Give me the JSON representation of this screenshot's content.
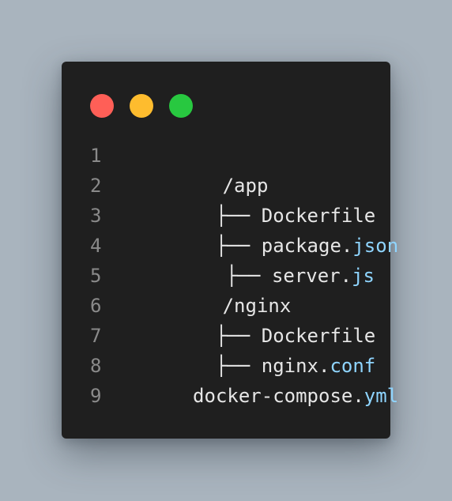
{
  "window": {
    "controls": [
      {
        "name": "close",
        "color": "#ff5f57"
      },
      {
        "name": "minimize",
        "color": "#febc2e"
      },
      {
        "name": "zoom",
        "color": "#28c840"
      }
    ]
  },
  "code": {
    "lines": [
      {
        "number": "1",
        "prefix": "",
        "base": "/app",
        "ext": ""
      },
      {
        "number": "2",
        "prefix": "  ├── ",
        "base": "Dockerfile",
        "ext": ""
      },
      {
        "number": "3",
        "prefix": "  ├── ",
        "base": "package.",
        "ext": "json"
      },
      {
        "number": "4",
        "prefix": "  ├── ",
        "base": "server.",
        "ext": "js"
      },
      {
        "number": "5",
        "prefix": "",
        "base": "/nginx",
        "ext": ""
      },
      {
        "number": "6",
        "prefix": "  ├── ",
        "base": "Dockerfile",
        "ext": ""
      },
      {
        "number": "7",
        "prefix": "  ├── ",
        "base": "nginx.",
        "ext": "conf"
      },
      {
        "number": "8",
        "prefix": "",
        "base": "docker-compose.",
        "ext": "yml"
      },
      {
        "number": "9",
        "prefix": "",
        "base": "",
        "ext": ""
      }
    ]
  },
  "colors": {
    "background": "#a9b4be",
    "panel": "#1f1f1f",
    "text": "#e6e6e6",
    "line_number": "#8a8a8a",
    "extension": "#8fd5ff"
  }
}
